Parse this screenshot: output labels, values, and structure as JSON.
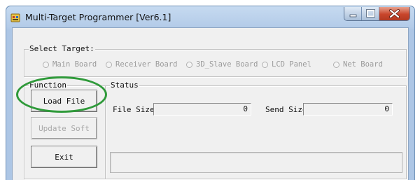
{
  "window": {
    "title": "Multi-Target Programmer [Ver6.1]",
    "controls": {
      "minimize": "minimize-icon",
      "maximize": "maximize-icon",
      "close": "close-icon"
    }
  },
  "select_target": {
    "label": "Select Target:",
    "options": [
      {
        "label": "Main Board",
        "selected": false,
        "enabled": false
      },
      {
        "label": "Receiver Board",
        "selected": false,
        "enabled": false
      },
      {
        "label": "3D_Slave Board",
        "selected": false,
        "enabled": false
      },
      {
        "label": "LCD Panel",
        "selected": false,
        "enabled": false
      },
      {
        "label": "Net Board",
        "selected": false,
        "enabled": false
      }
    ]
  },
  "function": {
    "label": "Function",
    "load_file": "Load File",
    "update_soft": "Update Soft",
    "exit": "Exit"
  },
  "status": {
    "label": "Status",
    "file_size_label": "File Size:",
    "file_size_value": "0",
    "send_size_label": "Send Size",
    "send_size_value": "0",
    "progress": 0
  },
  "colors": {
    "highlight": "#2f9a3a",
    "close_button": "#c8452b"
  }
}
